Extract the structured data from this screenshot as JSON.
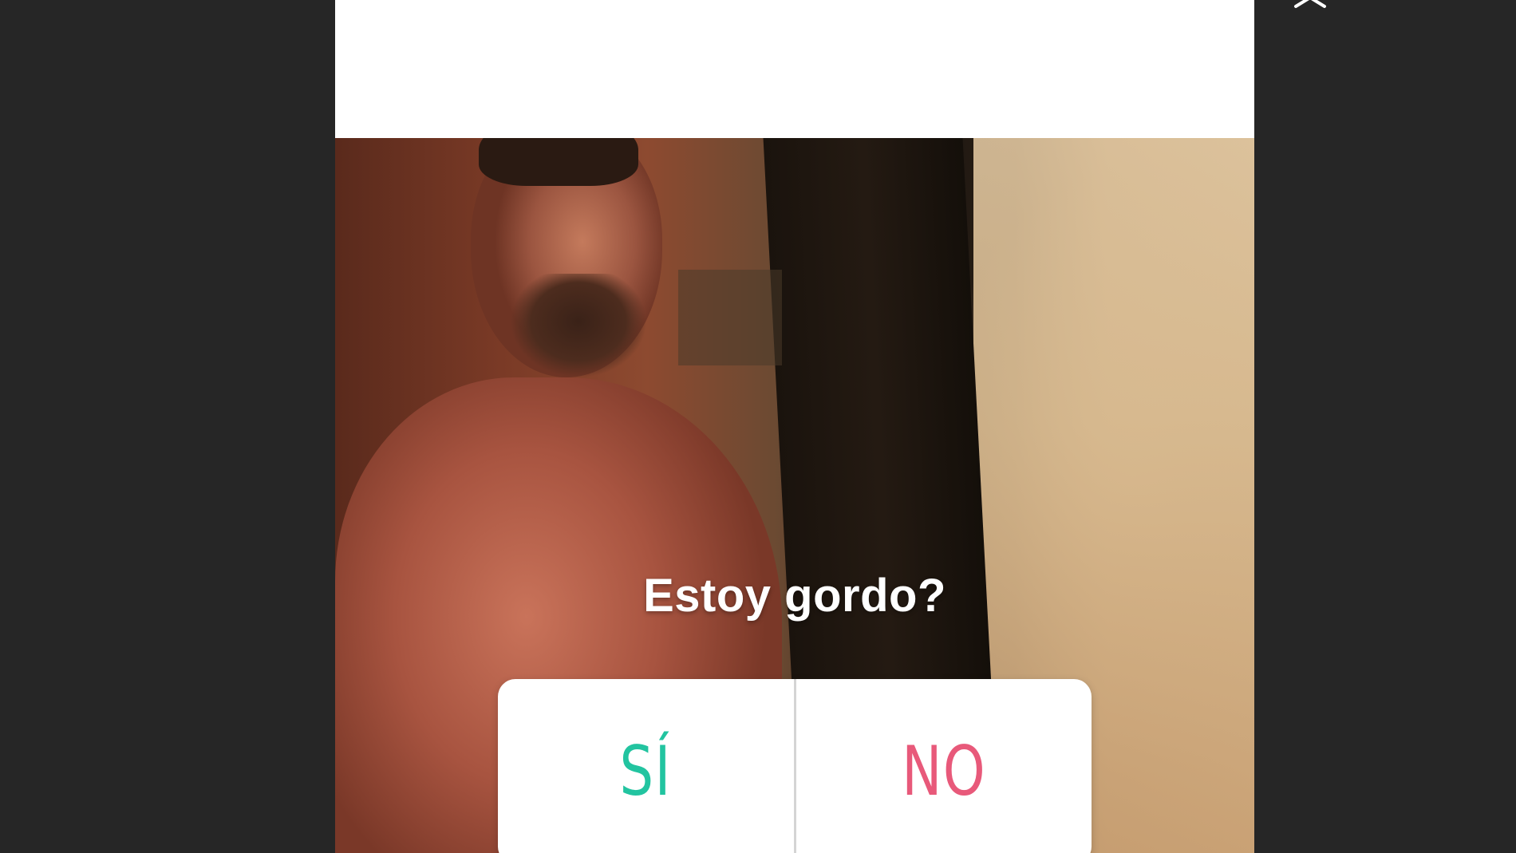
{
  "story": {
    "question": "Estoy gordo?",
    "poll": {
      "option_yes": "SÍ",
      "option_no": "NO",
      "option_yes_color": "#22c4a0",
      "option_no_color": "#e8597a"
    }
  },
  "viewer": {
    "close_icon": "close-icon",
    "background_color": "#262626"
  }
}
